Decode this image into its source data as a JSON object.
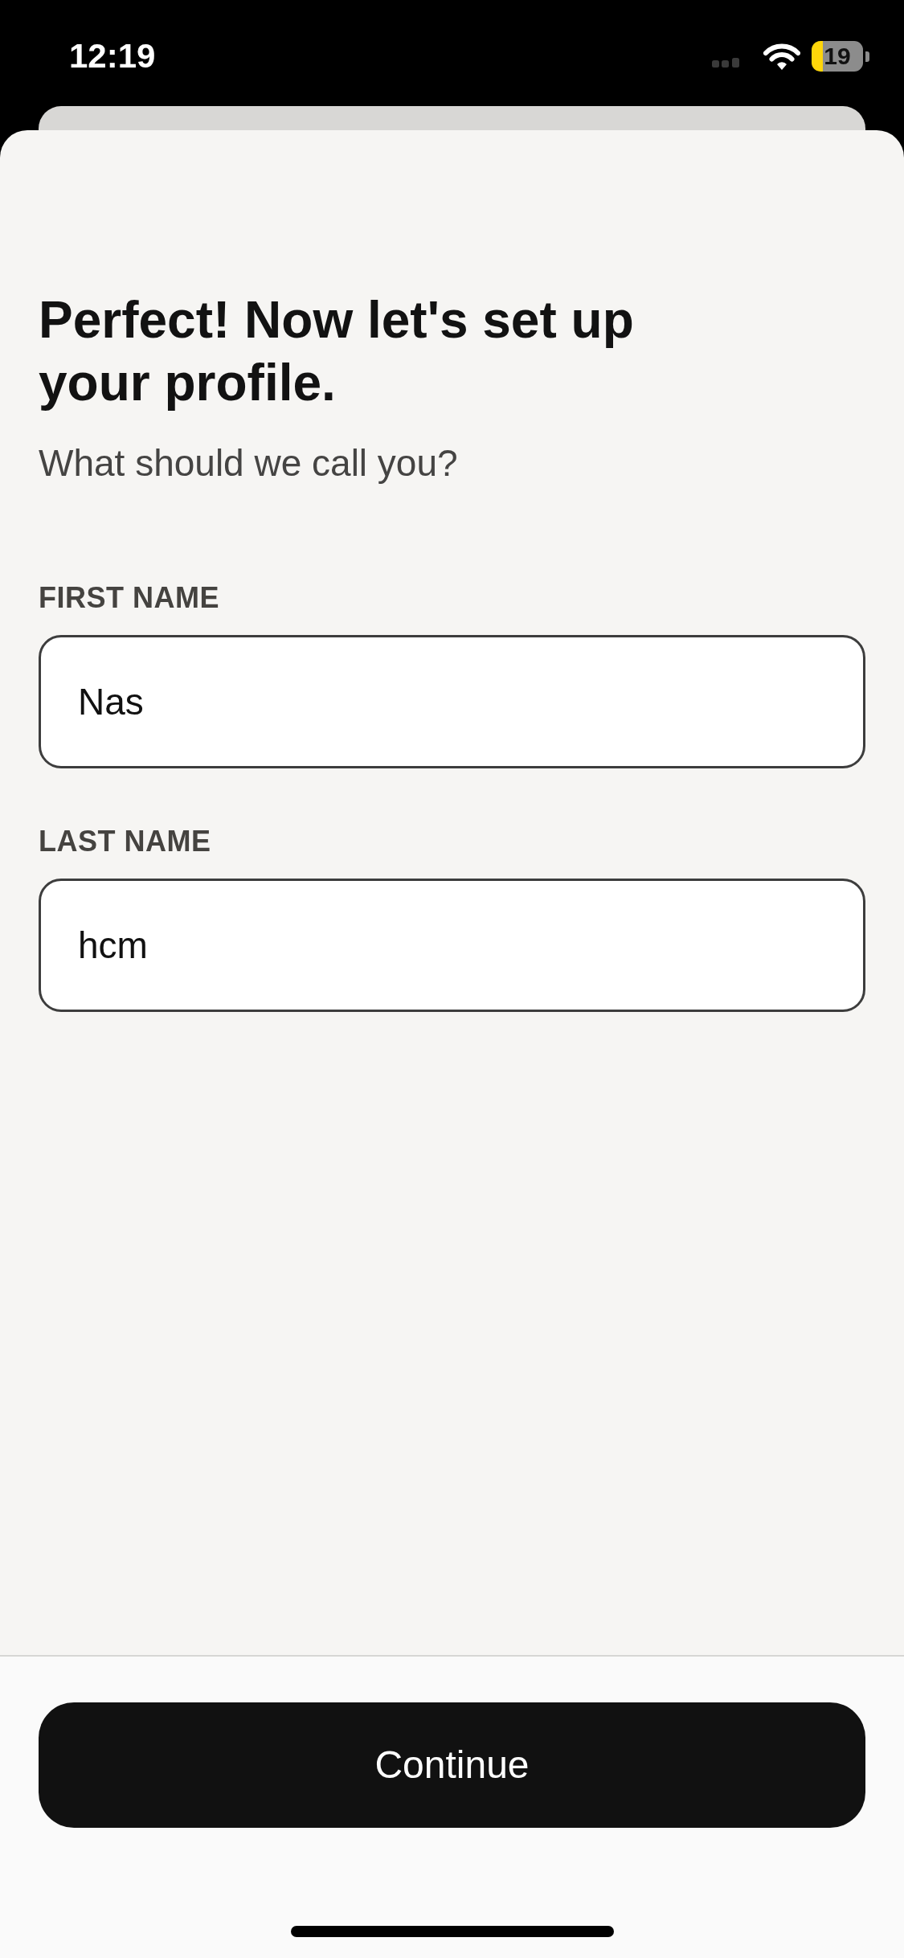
{
  "status_bar": {
    "time": "12:19",
    "battery": "19"
  },
  "sheet": {
    "title": "Perfect! Now let's set up your profile.",
    "subtitle": "What should we call you?",
    "fields": [
      {
        "label": "FIRST NAME",
        "value": "Nas"
      },
      {
        "label": "LAST NAME",
        "value": "hcm"
      }
    ],
    "continue_button": "Continue"
  }
}
